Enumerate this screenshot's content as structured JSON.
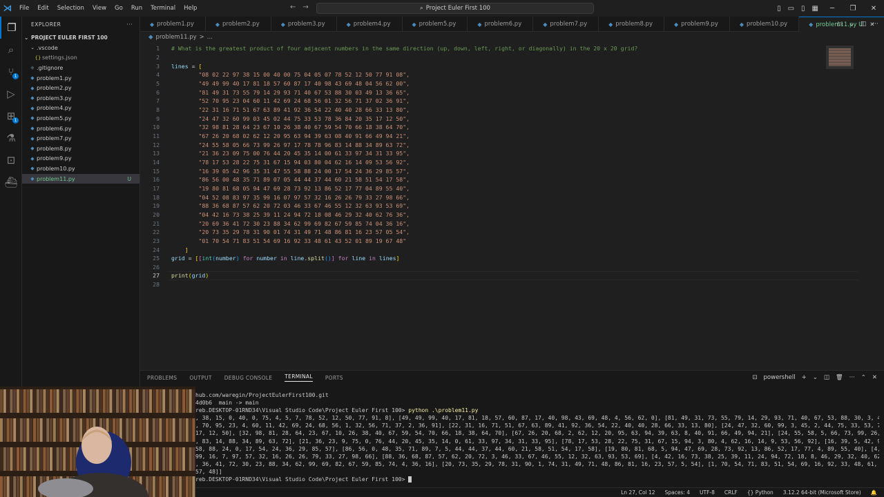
{
  "titlebar": {
    "menu": [
      "File",
      "Edit",
      "Selection",
      "View",
      "Go",
      "Run",
      "Terminal",
      "Help"
    ],
    "search_text": "Project Euler First 100"
  },
  "sidebar": {
    "title": "EXPLORER",
    "folder": "PROJECT EULER FIRST 100",
    "vscode_folder": ".vscode",
    "settings_file": "settings.json",
    "gitignore": ".gitignore",
    "files": [
      "problem1.py",
      "problem2.py",
      "problem3.py",
      "problem4.py",
      "problem5.py",
      "problem6.py",
      "problem7.py",
      "problem8.py",
      "problem9.py",
      "problem10.py",
      "problem11.py"
    ],
    "selected_mark": "U"
  },
  "tabs": [
    "problem1.py",
    "problem2.py",
    "problem3.py",
    "problem4.py",
    "problem5.py",
    "problem6.py",
    "problem7.py",
    "problem8.py",
    "problem9.py",
    "problem10.py",
    "problem11.py U"
  ],
  "breadcrumb": {
    "file": "problem11.py",
    "sep": ">",
    "rest": "..."
  },
  "editor": {
    "comment": "# What is the greatest product of four adjacent numbers in the same direction (up, down, left, right, or diagonally) in the 20 x 20 grid?",
    "var_lines": "lines",
    "rows": [
      "08 02 22 97 38 15 00 40 00 75 04 05 07 78 52 12 50 77 91 08",
      "49 49 99 40 17 81 18 57 60 87 17 40 98 43 69 48 04 56 62 00",
      "81 49 31 73 55 79 14 29 93 71 40 67 53 88 30 03 49 13 36 65",
      "52 70 95 23 04 60 11 42 69 24 68 56 01 32 56 71 37 02 36 91",
      "22 31 16 71 51 67 63 89 41 92 36 54 22 40 40 28 66 33 13 80",
      "24 47 32 60 99 03 45 02 44 75 33 53 78 36 84 20 35 17 12 50",
      "32 98 81 28 64 23 67 10 26 38 40 67 59 54 70 66 18 38 64 70",
      "67 26 20 68 02 62 12 20 95 63 94 39 63 08 40 91 66 49 94 21",
      "24 55 58 05 66 73 99 26 97 17 78 78 96 83 14 88 34 89 63 72",
      "21 36 23 09 75 00 76 44 20 45 35 14 00 61 33 97 34 31 33 95",
      "78 17 53 28 22 75 31 67 15 94 03 80 04 62 16 14 09 53 56 92",
      "16 39 05 42 96 35 31 47 55 58 88 24 00 17 54 24 36 29 85 57",
      "86 56 00 48 35 71 89 07 05 44 44 37 44 60 21 58 51 54 17 58",
      "19 80 81 68 05 94 47 69 28 73 92 13 86 52 17 77 04 89 55 40",
      "04 52 08 83 97 35 99 16 07 97 57 32 16 26 26 79 33 27 98 66",
      "88 36 68 87 57 62 20 72 03 46 33 67 46 55 12 32 63 93 53 69",
      "04 42 16 73 38 25 39 11 24 94 72 18 08 46 29 32 40 62 76 36",
      "20 69 36 41 72 30 23 88 34 62 99 69 82 67 59 85 74 04 36 16",
      "20 73 35 29 78 31 90 01 74 31 49 71 48 86 81 16 23 57 05 54",
      "01 70 54 71 83 51 54 69 16 92 33 48 61 43 52 01 89 19 67 48"
    ],
    "grid_var": "grid",
    "int_fn": "int",
    "number_var": "number",
    "for_kw": "for",
    "in_kw": "in",
    "line_var": "line",
    "split_fn": "split",
    "print_fn": "print"
  },
  "panel": {
    "tabs": [
      "PROBLEMS",
      "OUTPUT",
      "DEBUG CONSOLE",
      "TERMINAL",
      "PORTS"
    ],
    "shell": "powershell",
    "lines": [
      "hub.com/waregin/ProjectEulerFirst100.git",
      "4d0b6  main -> main",
      "reb.DESKTOP-01RND34\\Visual Studio Code\\Project Euler First 100> ",
      ", 38, 15, 0, 40, 0, 75, 4, 5, 7, 78, 52, 12, 50, 77, 91, 8], [49, 49, 99, 40, 17, 81, 18, 57, 60, 87, 17, 40, 98, 43, 69, 48, 4, 56, 62, 0], [81, 49, 31, 73, 55, 79, 14, 29, 93, 71, 40, 67, 53, 88, 30, 3, 49, 13",
      ", 70, 95, 23, 4, 60, 11, 42, 69, 24, 68, 56, 1, 32, 56, 71, 37, 2, 36, 91], [22, 31, 16, 71, 51, 67, 63, 89, 41, 92, 36, 54, 22, 40, 40, 28, 66, 33, 13, 80], [24, 47, 32, 60, 99, 3, 45, 2, 44, 75, 33, 53, 78, 36",
      "17, 12, 50], [32, 98, 81, 28, 64, 23, 67, 10, 26, 38, 40, 67, 59, 54, 70, 66, 18, 38, 64, 70], [67, 26, 20, 68, 2, 62, 12, 20, 95, 63, 94, 39, 63, 8, 40, 91, 66, 49, 94, 21], [24, 55, 58, 5, 66, 73, 99, 26, 97,",
      ", 83, 14, 88, 34, 89, 63, 72], [21, 36, 23, 9, 75, 0, 76, 44, 20, 45, 35, 14, 0, 61, 33, 97, 34, 31, 33, 95], [78, 17, 53, 28, 22, 75, 31, 67, 15, 94, 3, 80, 4, 62, 16, 14, 9, 53, 56, 92], [16, 39, 5, 42, 96, 35",
      "58, 88, 24, 0, 17, 54, 24, 36, 29, 85, 57], [86, 56, 0, 48, 35, 71, 89, 7, 5, 44, 44, 37, 44, 60, 21, 58, 51, 54, 17, 58], [19, 80, 81, 68, 5, 94, 47, 69, 28, 73, 92, 13, 86, 52, 17, 77, 4, 89, 55, 40], [4, 52,",
      "99, 16, 7, 97, 57, 32, 16, 26, 26, 79, 33, 27, 98, 66], [88, 36, 68, 87, 57, 62, 20, 72, 3, 46, 33, 67, 46, 55, 12, 32, 63, 93, 53, 69], [4, 42, 16, 73, 38, 25, 39, 11, 24, 94, 72, 18, 8, 46, 29, 32, 40, 62, 76",
      ", 36, 41, 72, 30, 23, 88, 34, 62, 99, 69, 82, 67, 59, 85, 74, 4, 36, 16], [20, 73, 35, 29, 78, 31, 90, 1, 74, 31, 49, 71, 48, 86, 81, 16, 23, 57, 5, 54], [1, 70, 54, 71, 83, 51, 54, 69, 16, 92, 33, 48, 61, 43, 5",
      "57, 48]]",
      "reb.DESKTOP-01RND34\\Visual Studio Code\\Project Euler First 100> "
    ],
    "command": "python .\\problem11.py"
  },
  "statusbar": {
    "position": "Ln 27, Col 12",
    "spaces": "Spaces: 4",
    "encoding": "UTF-8",
    "eol": "CRLF",
    "language": "Python",
    "interpreter": "3.12.2 64-bit (Microsoft Store)"
  },
  "colors": {
    "accent": "#0078d4",
    "modified": "#73c991",
    "string": "#ce9178"
  },
  "icons": [
    "vscode-logo-icon",
    "explorer-icon",
    "search-icon",
    "source-control-icon",
    "run-debug-icon",
    "extensions-icon",
    "testing-icon",
    "remote-explorer-icon",
    "docker-icon"
  ]
}
